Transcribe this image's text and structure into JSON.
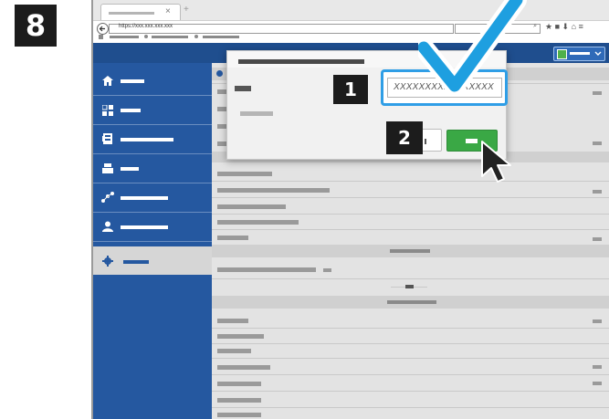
{
  "step": {
    "number": "8"
  },
  "browser": {
    "tab_close": "×",
    "new_tab": "+",
    "url": "https://xxx.xxx.xxx.xxx",
    "toolbar_icons": [
      "star-icon",
      "bookmark-icon",
      "download-icon",
      "home-icon",
      "menu-icon"
    ]
  },
  "dialog": {
    "password_value": "XXXXXXXXXXXXXXXX",
    "callout_1": "1",
    "callout_2": "2"
  },
  "colors": {
    "header_blue": "#1f4e8e",
    "sidebar_blue": "#2558a0",
    "accent_blue": "#2f9ee6",
    "ok_green": "#3aa845",
    "check_blue": "#1e9fe0"
  }
}
